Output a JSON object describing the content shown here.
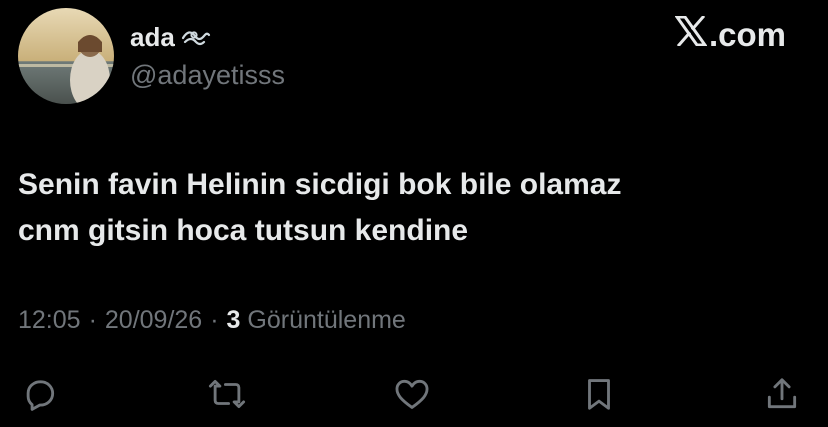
{
  "author": {
    "display_name": "ada",
    "display_name_emoji": "wave-emoji",
    "handle": "@adayetisss",
    "avatar_icon": "user-avatar"
  },
  "brand": {
    "label": ".com",
    "logo_icon": "x-logo-icon"
  },
  "tweet": {
    "text_line1": "Senin favin Helinin sicdigi bok bile olamaz",
    "text_line2": "cnm gitsin hoca tutsun kendine"
  },
  "meta": {
    "time": "12:05",
    "sep1": "·",
    "date": "20/09/26",
    "sep2": "·",
    "views_count": "3",
    "views_label": "Görüntülenme"
  },
  "actions": [
    {
      "icon": "reply-icon"
    },
    {
      "icon": "retweet-icon"
    },
    {
      "icon": "like-icon"
    },
    {
      "icon": "bookmark-icon"
    },
    {
      "icon": "share-icon"
    }
  ],
  "colors": {
    "background": "#000000",
    "primary_text": "#e7e9ea",
    "secondary_text": "#71767b"
  }
}
